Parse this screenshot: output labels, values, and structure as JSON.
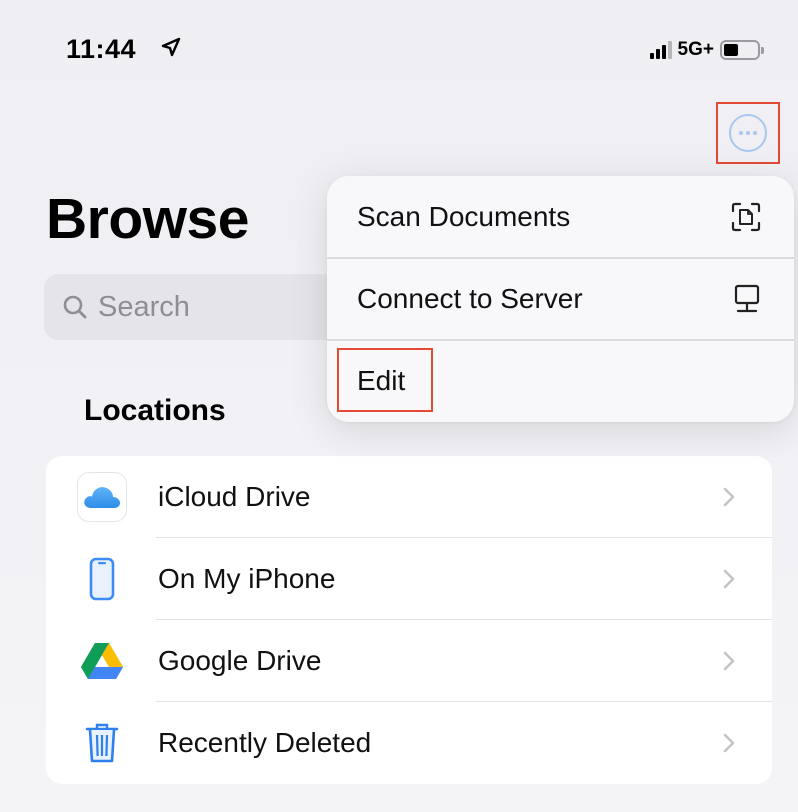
{
  "status_bar": {
    "time": "11:44",
    "network": "5G+",
    "signal_bars_active": 3,
    "battery_level_fraction": 0.45
  },
  "header": {
    "title": "Browse",
    "more_button_icon": "ellipsis-circle-icon"
  },
  "search": {
    "placeholder": "Search",
    "icon": "magnifier-icon"
  },
  "locations": {
    "heading": "Locations",
    "items": [
      {
        "label": "iCloud Drive",
        "icon": "icloud-icon"
      },
      {
        "label": "On My iPhone",
        "icon": "iphone-icon"
      },
      {
        "label": "Google Drive",
        "icon": "google-drive-icon"
      },
      {
        "label": "Recently Deleted",
        "icon": "trash-icon"
      }
    ]
  },
  "menu": {
    "items": [
      {
        "label": "Scan Documents",
        "icon": "scan-document-icon"
      },
      {
        "label": "Connect to Server",
        "icon": "display-server-icon"
      },
      {
        "label": "Edit",
        "icon": ""
      }
    ]
  },
  "colors": {
    "accent": "#007aff",
    "highlight_box": "#e24a35",
    "background": "#f2f2f7"
  }
}
